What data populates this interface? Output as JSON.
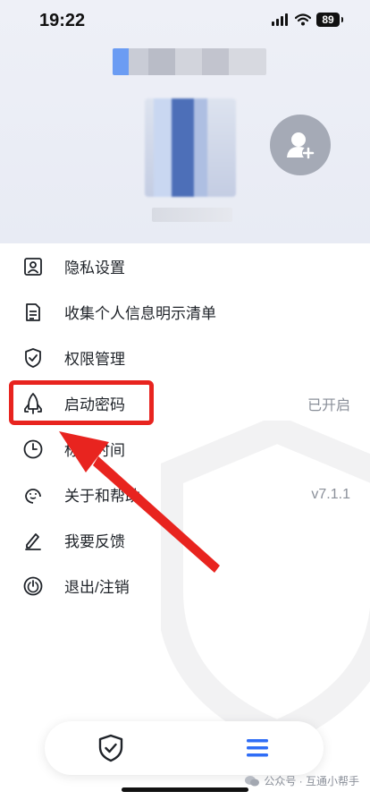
{
  "status_bar": {
    "time": "19:22",
    "battery": "89"
  },
  "menu": {
    "items": [
      {
        "label": "隐私设置",
        "value": "",
        "icon": "user-card-icon"
      },
      {
        "label": "收集个人信息明示清单",
        "value": "",
        "icon": "document-list-icon"
      },
      {
        "label": "权限管理",
        "value": "",
        "icon": "shield-check-icon"
      },
      {
        "label": "启动密码",
        "value": "已开启",
        "icon": "rocket-icon"
      },
      {
        "label": "标准时间",
        "value": "",
        "icon": "clock-icon"
      },
      {
        "label": "关于和帮助",
        "value": "v7.1.1",
        "icon": "support-face-icon"
      },
      {
        "label": "我要反馈",
        "value": "",
        "icon": "pen-icon"
      },
      {
        "label": "退出/注销",
        "value": "",
        "icon": "power-icon"
      }
    ]
  },
  "tabs": [
    {
      "name": "security",
      "icon": "shield-check-icon",
      "active": false
    },
    {
      "name": "menu",
      "icon": "hamburger-icon",
      "active": true
    }
  ],
  "watermark": {
    "text": "公众号 · 互通小帮手"
  },
  "colors": {
    "accent": "#2f6df6",
    "highlight": "#e8241f",
    "hero_bg": "#eef0f7"
  }
}
